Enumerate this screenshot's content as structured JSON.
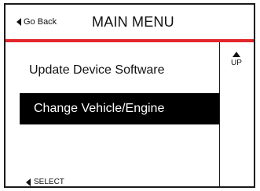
{
  "header": {
    "back_label": "Go Back",
    "title": "MAIN MENU"
  },
  "menu": {
    "items": [
      {
        "label": "Update Device Software",
        "selected": false
      },
      {
        "label": "Change Vehicle/Engine",
        "selected": true
      }
    ]
  },
  "controls": {
    "up_label": "UP",
    "select_label": "SELECT"
  },
  "colors": {
    "accent_bar": "#e3262c",
    "selected_background": "#000000",
    "selected_text": "#ffffff"
  },
  "icons": {
    "back": "triangle-left-icon",
    "up": "triangle-up-icon",
    "select": "triangle-left-icon"
  }
}
